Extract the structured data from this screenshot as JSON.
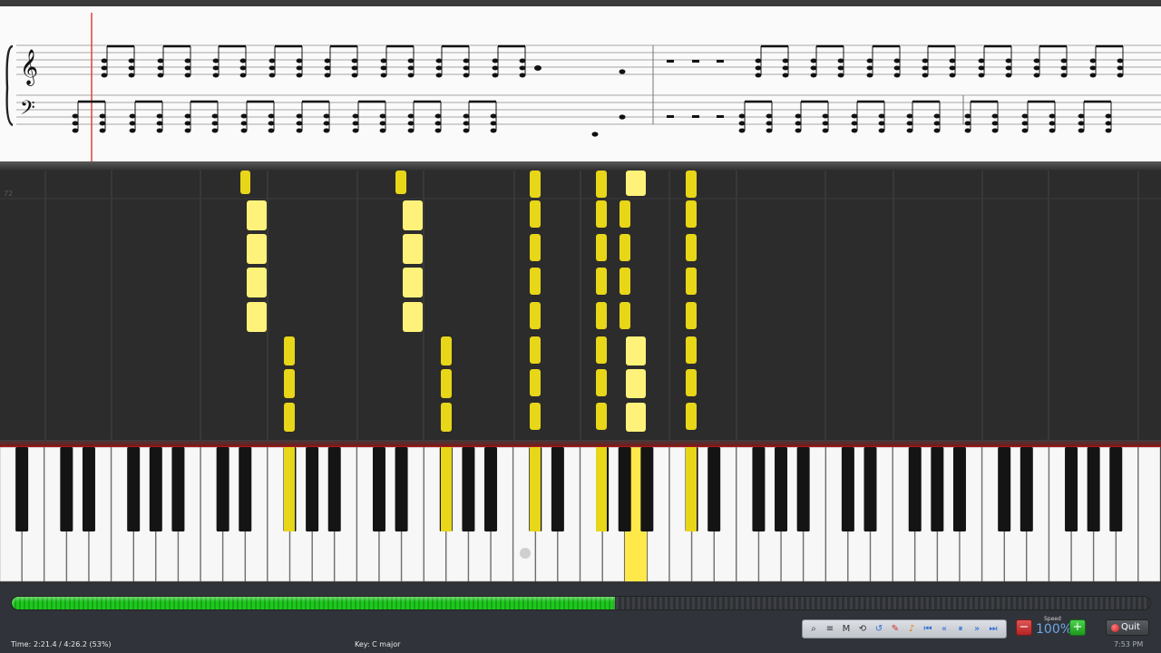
{
  "status": {
    "time_label": "Time:",
    "time_value": "2:21.4 / 4:26.2 (53%)",
    "key": "Key: C major",
    "clock": "7:53 PM"
  },
  "progress": {
    "fraction": 0.53
  },
  "roll": {
    "octave_label": "72"
  },
  "controls": {
    "speed_label": "Speed",
    "speed_value": "100%",
    "speed_minus": "−",
    "speed_plus": "+",
    "quit_label": "Quit",
    "tools": [
      {
        "icon": "zoom-icon",
        "glyph": "⌕",
        "tone": "dark"
      },
      {
        "icon": "score-icon",
        "glyph": "≡",
        "tone": "dark"
      },
      {
        "icon": "metronome-icon",
        "glyph": "M",
        "tone": "dark"
      },
      {
        "icon": "loop-icon",
        "glyph": "⟲",
        "tone": "dark"
      },
      {
        "icon": "rewind-loop-icon",
        "glyph": "↺",
        "tone": "blue"
      },
      {
        "icon": "pen-icon",
        "glyph": "✎",
        "tone": "red"
      },
      {
        "icon": "bell-icon",
        "glyph": "♪",
        "tone": "orange"
      },
      {
        "icon": "skip-start-icon",
        "glyph": "⏮",
        "tone": "blue"
      },
      {
        "icon": "rewind-icon",
        "glyph": "«",
        "tone": "blue"
      },
      {
        "icon": "pause-icon",
        "glyph": "⏸",
        "tone": "blue"
      },
      {
        "icon": "forward-icon",
        "glyph": "»",
        "tone": "blue"
      },
      {
        "icon": "skip-end-icon",
        "glyph": "⏭",
        "tone": "blue"
      }
    ]
  },
  "colors": {
    "note": "#e8d619",
    "note_active": "#fff27a",
    "progress": "#1ec81e",
    "accent": "#6fa6e6"
  }
}
